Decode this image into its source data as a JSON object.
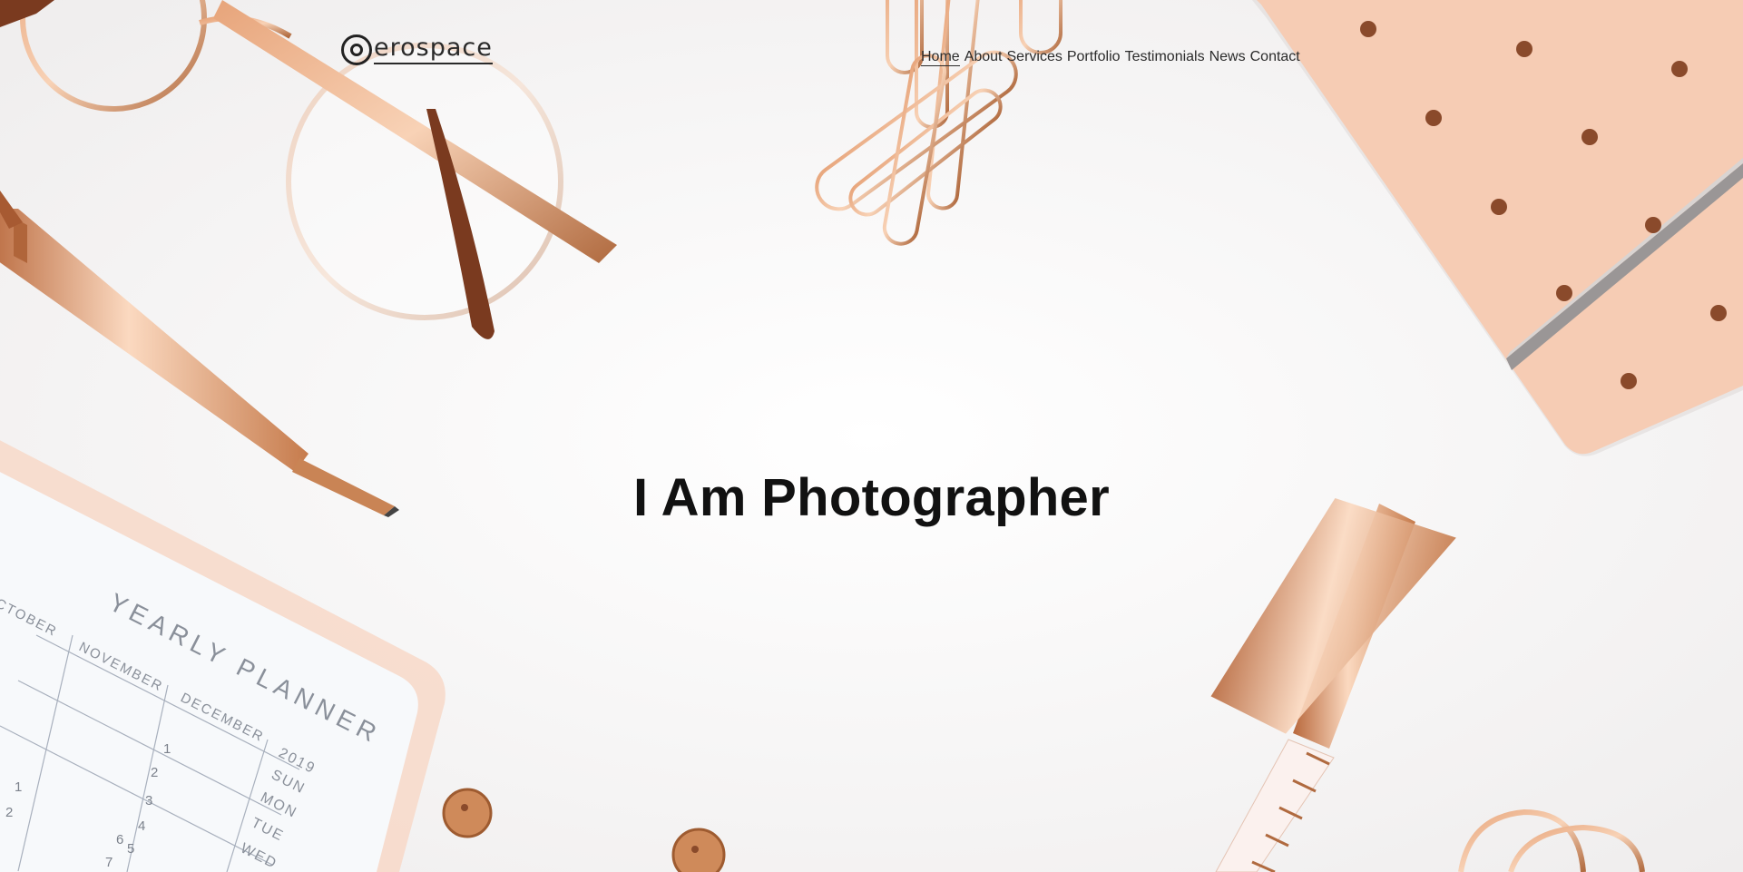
{
  "brand": {
    "logo_text": "erospace"
  },
  "nav": {
    "items": [
      {
        "label": "Home",
        "active": true
      },
      {
        "label": "About"
      },
      {
        "label": "Services"
      },
      {
        "label": "Portfolio"
      },
      {
        "label": "Testimonials"
      },
      {
        "label": "News"
      },
      {
        "label": "Contact"
      }
    ]
  },
  "hero": {
    "title": "I Am Photographer"
  },
  "planner": {
    "heading": "YEARLY PLANNER",
    "months": [
      "CTOBER",
      "NOVEMBER",
      "DECEMBER"
    ],
    "year": "2019",
    "days": [
      "SUN",
      "MON",
      "TUE",
      "WED"
    ],
    "numbers": [
      "1",
      "2",
      "3",
      "4",
      "5",
      "6",
      "7",
      "2",
      "3"
    ]
  },
  "colors": {
    "rose_gold": "#c98455",
    "blush_notebook": "#f5c9b0",
    "dot": "#8a4a2b",
    "background": "#f4f3f3"
  }
}
